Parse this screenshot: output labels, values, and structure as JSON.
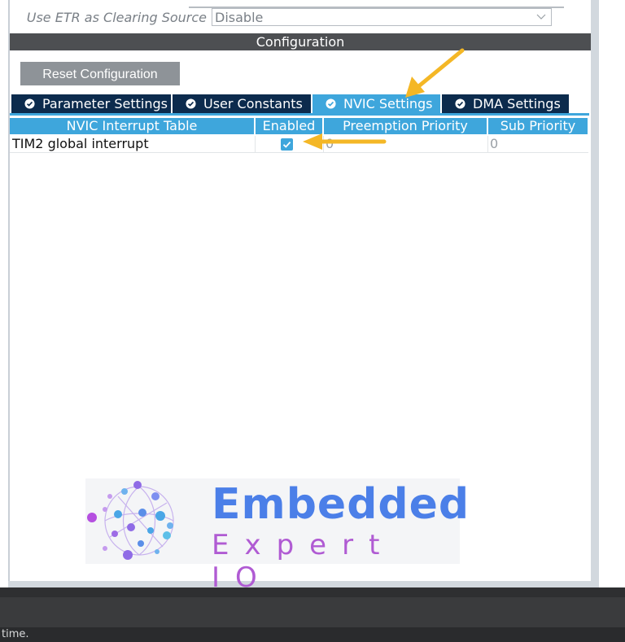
{
  "clipped_row": {
    "label": "Use ETR as Clearing Source",
    "value": "Disable"
  },
  "config_header": {
    "title": "Configuration"
  },
  "toolbar": {
    "reset_label": "Reset Configuration"
  },
  "tabs": [
    {
      "label": "Parameter Settings",
      "active": false
    },
    {
      "label": "User Constants",
      "active": false
    },
    {
      "label": "NVIC Settings",
      "active": true
    },
    {
      "label": "DMA Settings",
      "active": false
    }
  ],
  "table": {
    "headers": [
      "NVIC Interrupt Table",
      "Enabled",
      "Preemption Priority",
      "Sub Priority"
    ],
    "rows": [
      {
        "name": "TIM2 global interrupt",
        "enabled": true,
        "preemption": "0",
        "sub": "0"
      }
    ]
  },
  "logo": {
    "line1": "Embedded",
    "line2": "Expert IO"
  },
  "status": {
    "text": "time."
  },
  "colors": {
    "tab_active": "#3ea6dc",
    "tab_inactive": "#0c2b4d",
    "header_dark": "#4d4f52",
    "annotation_arrow": "#f4b726"
  }
}
